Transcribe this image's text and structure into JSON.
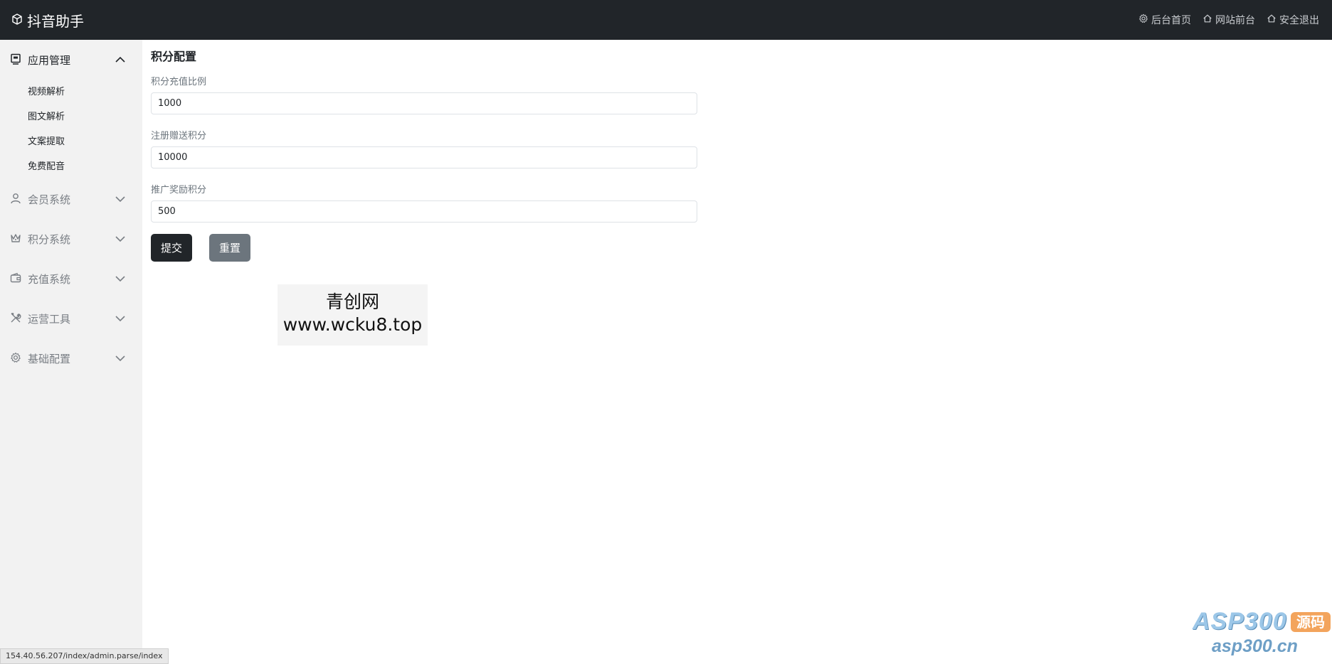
{
  "app": {
    "title": "抖音助手"
  },
  "header": {
    "links": [
      {
        "label": "后台首页",
        "icon": "gear-icon"
      },
      {
        "label": "网站前台",
        "icon": "home-icon"
      },
      {
        "label": "安全退出",
        "icon": "home-icon"
      }
    ]
  },
  "sidebar": {
    "groups": [
      {
        "label": "应用管理",
        "icon": "app-icon",
        "expanded": true,
        "items": [
          "视频解析",
          "图文解析",
          "文案提取",
          "免费配音"
        ]
      },
      {
        "label": "会员系统",
        "icon": "user-icon",
        "expanded": false
      },
      {
        "label": "积分系统",
        "icon": "crown-icon",
        "expanded": false
      },
      {
        "label": "充值系统",
        "icon": "wallet-icon",
        "expanded": false
      },
      {
        "label": "运营工具",
        "icon": "tools-icon",
        "expanded": false
      },
      {
        "label": "基础配置",
        "icon": "gear-icon",
        "expanded": false
      }
    ]
  },
  "main": {
    "title": "积分配置",
    "fields": [
      {
        "label": "积分充值比例",
        "value": "1000"
      },
      {
        "label": "注册赠送积分",
        "value": "10000"
      },
      {
        "label": "推广奖励积分",
        "value": "500"
      }
    ],
    "submit_label": "提交",
    "reset_label": "重置"
  },
  "overlay": {
    "watermark_line1": "青创网",
    "watermark_line2": "www.wcku8.top",
    "status_url": "154.40.56.207/index/admin.parse/index",
    "logo_text": "ASP300",
    "logo_tag": "源码",
    "logo_url": "asp300.cn"
  },
  "colors": {
    "topbar": "#212529",
    "sidebar": "#f2f2f2",
    "submit": "#212529",
    "reset": "#6c757d"
  }
}
